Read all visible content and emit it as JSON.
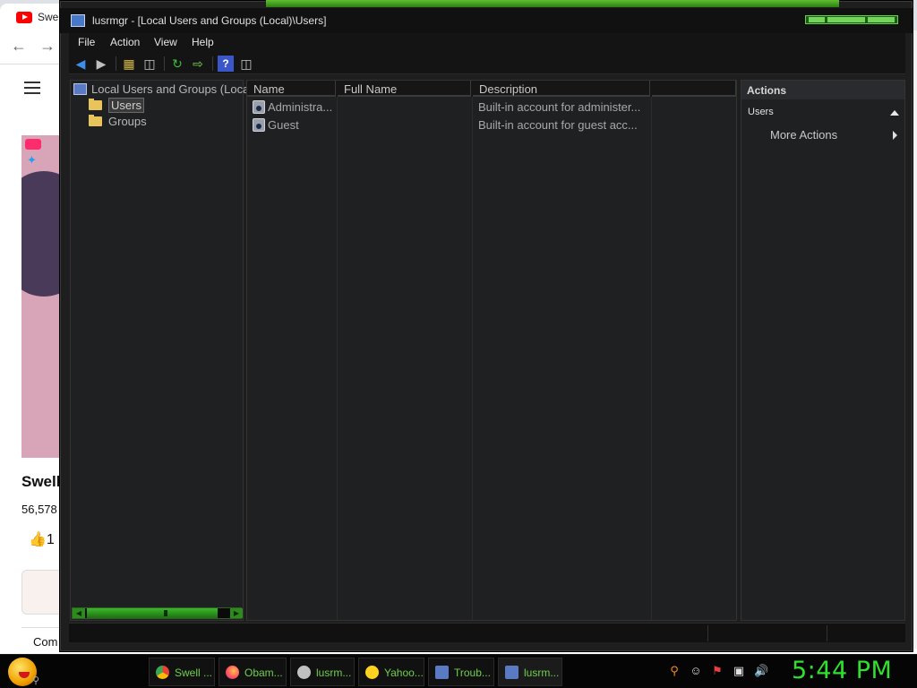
{
  "background_browser": {
    "tab_title": "Swe",
    "video_title": "Swell",
    "views": "56,578",
    "like_count": "1",
    "comments_label": "Com"
  },
  "window": {
    "title": "lusrmgr - [Local Users and Groups (Local)\\Users]"
  },
  "menu": {
    "file": "File",
    "action": "Action",
    "view": "View",
    "help": "Help"
  },
  "toolbar": {
    "icons": [
      "back-icon",
      "forward-icon",
      "up-folder-icon",
      "show-hide-tree-icon",
      "refresh-icon",
      "export-list-icon",
      "help-icon",
      "show-hide-action-pane-icon"
    ]
  },
  "tree": {
    "root": "Local Users and Groups (Local)",
    "items": [
      {
        "label": "Users",
        "selected": true
      },
      {
        "label": "Groups",
        "selected": false
      }
    ]
  },
  "list": {
    "columns": [
      "Name",
      "Full Name",
      "Description",
      ""
    ],
    "rows": [
      {
        "name": "Administra...",
        "full_name": "",
        "description": "Built-in account for administer..."
      },
      {
        "name": "Guest",
        "full_name": "",
        "description": "Built-in account for guest acc..."
      }
    ]
  },
  "actions": {
    "title": "Actions",
    "section": "Users",
    "more": "More Actions"
  },
  "taskbar": {
    "buttons": [
      {
        "label": "Swell ...",
        "icon": "chrome-icon",
        "color": "#4285f4"
      },
      {
        "label": "Obam...",
        "icon": "firefox-icon",
        "color": "#ff7139"
      },
      {
        "label": "lusrm...",
        "icon": "mmc-icon",
        "color": "#c0c0c0"
      },
      {
        "label": "Yahoo...",
        "icon": "yahoo-messenger-icon",
        "color": "#ffd21f"
      },
      {
        "label": "Troub...",
        "icon": "troubleshoot-icon",
        "color": "#5a7bc4"
      },
      {
        "label": "lusrm...",
        "icon": "computer-management-icon",
        "color": "#5a7bc4"
      }
    ],
    "clock": "5:44 PM"
  },
  "theme": {
    "accent": "#2fe02f",
    "window_bg": "#1e1e1e",
    "text": "#b8b8b8"
  }
}
